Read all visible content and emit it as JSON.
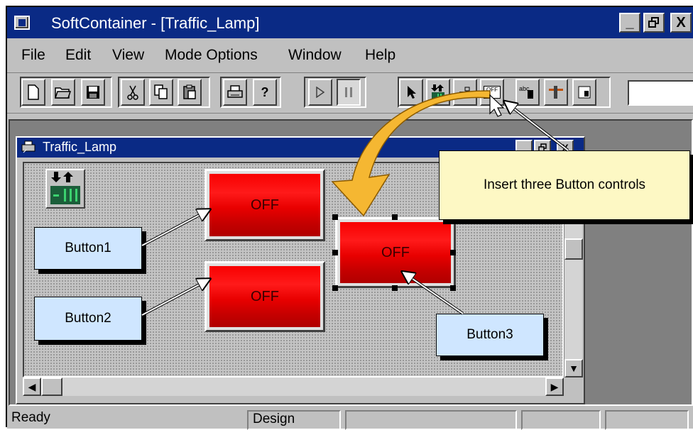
{
  "window": {
    "title": "SoftContainer - [Traffic_Lamp]"
  },
  "menu": [
    "File",
    "Edit",
    "View",
    "Mode Options",
    "Window",
    "Help"
  ],
  "child": {
    "title": "Traffic_Lamp"
  },
  "buttons": [
    {
      "caption": "OFF"
    },
    {
      "caption": "OFF"
    },
    {
      "caption": "OFF"
    }
  ],
  "callouts": {
    "button1": "Button1",
    "button2": "Button2",
    "button3": "Button3",
    "instruction": "Insert three Button controls"
  },
  "toolbar": {
    "off_label": "OFF",
    "abc_label": "abc"
  },
  "status": {
    "ready": "Ready",
    "mode": "Design"
  },
  "colors": {
    "title_bar": "#0a2a85",
    "button_red": "#e80000",
    "callout_blue": "#cfe6ff",
    "note_yellow": "#fdf8c4",
    "arrow_orange": "#f5b732"
  }
}
